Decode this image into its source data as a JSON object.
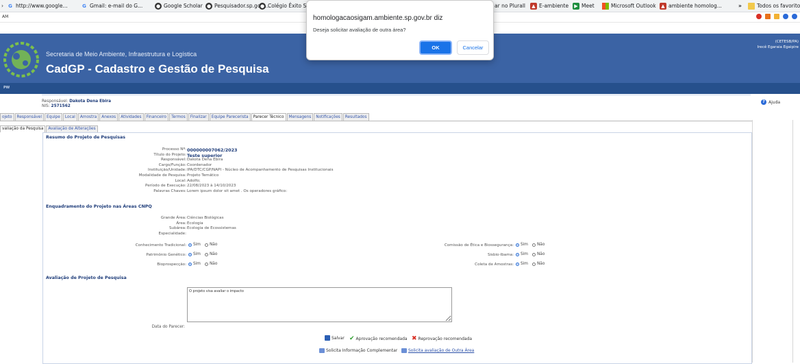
{
  "bookmarks": {
    "items": [
      {
        "label": "http://www.google...",
        "icon": "google-icon",
        "color": "#4285f4"
      },
      {
        "label": "Gmail: e-mail do G...",
        "icon": "google-icon",
        "color": "#4285f4"
      },
      {
        "label": "Google Scholar",
        "icon": "globe-icon",
        "color": "#333333"
      },
      {
        "label": "Pesquisador.sp.gov....",
        "icon": "globe-icon",
        "color": "#333333"
      },
      {
        "label": "Colégio Êxito São",
        "icon": "globe-icon",
        "color": "#333333"
      }
    ],
    "right_items": [
      {
        "label": "ar no Plurall"
      },
      {
        "label": "E-ambiente"
      },
      {
        "label": "Meet"
      },
      {
        "label": "Microsoft Outlook"
      },
      {
        "label": "ambiente homolog..."
      }
    ],
    "overflow": "»",
    "all_favorites": "Todos os favoritos",
    "left_edge": "AM"
  },
  "dialog": {
    "title": "homologacaosigam.ambiente.sp.gov.br diz",
    "message": "Deseja solicitar avaliação de outra área?",
    "ok": "OK",
    "cancel": "Cancelar"
  },
  "header": {
    "subtitle": "Secretaria de Meio Ambiente, Infraestrutura e Logística",
    "title": "CadGP - Cadastro e Gestão de Pesquisa",
    "user_line1": "(CETESB/PA)",
    "user_line2": "Irecê Egaraia Egaipire",
    "nav_text": "PW"
  },
  "info": {
    "responsavel_label": "Responsável:",
    "responsavel_value": "Dakota Dena Ebira",
    "nis_label": "NIS:",
    "nis_value": "2571562",
    "help": "Ajuda"
  },
  "tabs": [
    "ojeto",
    "Responsável",
    "Equipe",
    "Local",
    "Amostra",
    "Anexos",
    "Atividades",
    "Financeiro",
    "Termos",
    "Finalizar",
    "Equipe Parecerista",
    "Parecer Técnico",
    "Mensagens",
    "Notificações",
    "Resultados"
  ],
  "active_tab_index": 11,
  "subtabs": [
    "valiação da Pesquisa",
    "Avaliação de Alterações"
  ],
  "resumo": {
    "title": "Resumo do Projeto de Pesquisas",
    "fields": [
      {
        "label": "Processo Nº:",
        "value": "000000007062/2023",
        "bold": true
      },
      {
        "label": "Título do Projeto:",
        "value": "Teste superior",
        "bold": true
      },
      {
        "label": "Responsável:",
        "value": "Dakota Dena Ebira",
        "bold": false
      },
      {
        "label": "Cargo/Função:",
        "value": "Coordenador",
        "bold": false
      },
      {
        "label": "Instituição/Unidade:",
        "value": "IPA/DTC/CGP/NAPI - Núcleo de Acompanhamento de Pesquisas Institucionais",
        "bold": false
      },
      {
        "label": "Modalidade de Pesquisa:",
        "value": "Projeto Temático",
        "bold": false
      },
      {
        "label": "Local:",
        "value": "Adolfo;",
        "bold": false
      },
      {
        "label": "Período de Execução:",
        "value": "22/08/2023 à 14/10/2023",
        "bold": false
      },
      {
        "label": "Palavras Chaves:",
        "value": "Lorem ipsum dolor sit amet . Os operadores gráfico:",
        "bold": false
      }
    ]
  },
  "cnpq": {
    "title": "Enquadramento do Projeto nas Áreas CNPQ",
    "fields": [
      {
        "label": "Grande Área:",
        "value": "Ciências Biológicas"
      },
      {
        "label": "Área:",
        "value": "Ecologia"
      },
      {
        "label": "Subárea:",
        "value": "Ecologia de Ecossistemas"
      },
      {
        "label": "Especialidade:",
        "value": ""
      }
    ],
    "left_questions": [
      {
        "label": "Conhecimento Tradicional:",
        "selected": "Sim"
      },
      {
        "label": "Patrimônio Genético:",
        "selected": "Sim"
      },
      {
        "label": "Bioprospecção:",
        "selected": "Sim"
      }
    ],
    "right_questions": [
      {
        "label": "Comissão de Ética e Biossegurança:",
        "selected": "Sim"
      },
      {
        "label": "Sisbio-Ibama:",
        "selected": "Sim"
      },
      {
        "label": "Coleta de Amostras:",
        "selected": "Sim"
      }
    ],
    "yes": "Sim",
    "no": "Não"
  },
  "avaliacao": {
    "title": "Avaliação de Projeto de Pesquisa",
    "textarea_value": "O projeto visa avaliar o impacto",
    "date_label": "Data do Parecer:"
  },
  "actions": {
    "save": "Salvar",
    "approve": "Aprovação recomendada",
    "reject": "Reprovação recomendada",
    "request_info": "Solicita Informação Complementar",
    "request_other": "Solicita avaliação de Outra Área"
  }
}
